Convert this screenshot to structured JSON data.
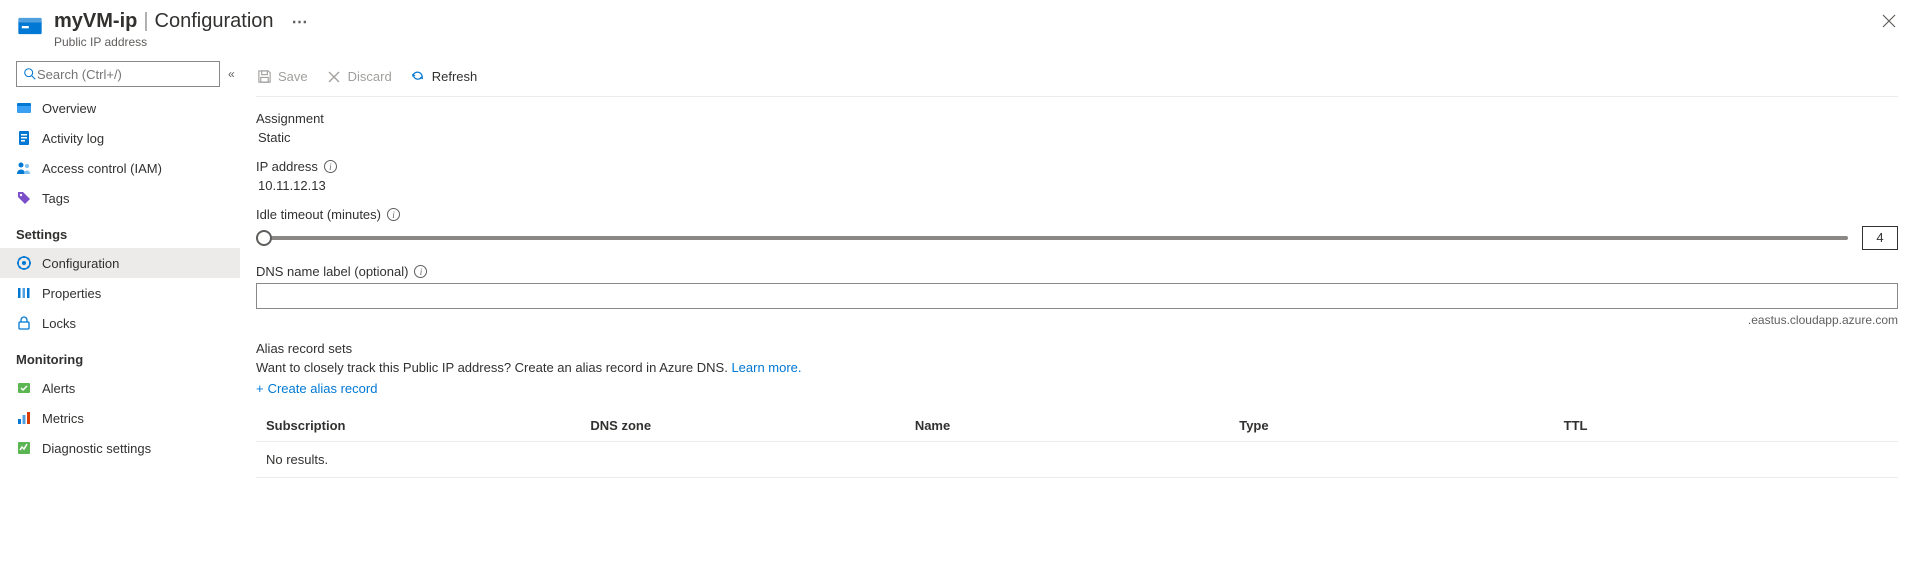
{
  "header": {
    "resource_name": "myVM-ip",
    "section": "Configuration",
    "subtitle": "Public IP address"
  },
  "sidebar": {
    "search_placeholder": "Search (Ctrl+/)",
    "items_top": [
      {
        "label": "Overview",
        "icon": "overview"
      },
      {
        "label": "Activity log",
        "icon": "activity"
      },
      {
        "label": "Access control (IAM)",
        "icon": "access"
      },
      {
        "label": "Tags",
        "icon": "tags"
      }
    ],
    "group_settings": "Settings",
    "items_settings": [
      {
        "label": "Configuration",
        "icon": "config",
        "active": true
      },
      {
        "label": "Properties",
        "icon": "properties"
      },
      {
        "label": "Locks",
        "icon": "locks"
      }
    ],
    "group_monitoring": "Monitoring",
    "items_monitoring": [
      {
        "label": "Alerts",
        "icon": "alerts"
      },
      {
        "label": "Metrics",
        "icon": "metrics"
      },
      {
        "label": "Diagnostic settings",
        "icon": "diag"
      }
    ]
  },
  "toolbar": {
    "save": "Save",
    "discard": "Discard",
    "refresh": "Refresh"
  },
  "fields": {
    "assignment_label": "Assignment",
    "assignment_value": "Static",
    "ip_label": "IP address",
    "ip_value": "10.11.12.13",
    "idle_label": "Idle timeout (minutes)",
    "idle_value": "4",
    "dns_label": "DNS name label (optional)",
    "dns_value": "",
    "dns_suffix": ".eastus.cloudapp.azure.com",
    "alias_heading": "Alias record sets",
    "alias_desc": "Want to closely track this Public IP address? Create an alias record in Azure DNS. ",
    "alias_learn": "Learn more.",
    "create_alias": "Create alias record"
  },
  "table": {
    "columns": [
      "Subscription",
      "DNS zone",
      "Name",
      "Type",
      "TTL"
    ],
    "empty": "No results."
  }
}
